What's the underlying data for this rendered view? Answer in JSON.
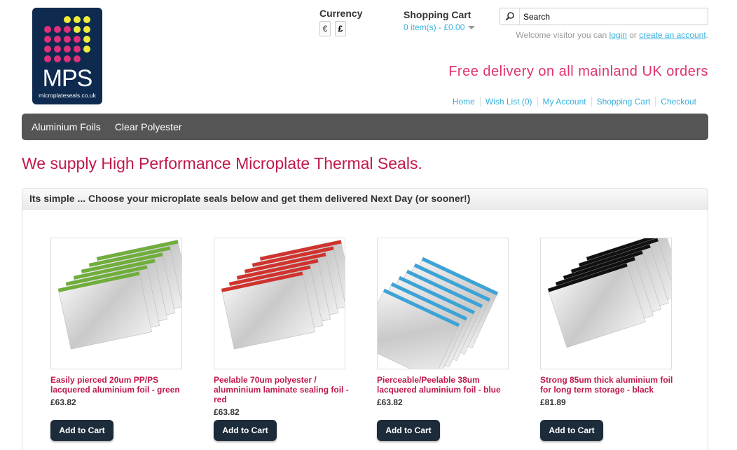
{
  "logo": {
    "brand": "MPS",
    "url": "microplateseals.co.uk"
  },
  "currency": {
    "title": "Currency",
    "options": [
      "€",
      "£"
    ]
  },
  "cart": {
    "title": "Shopping Cart",
    "summary": "0 item(s) - £0.00"
  },
  "search": {
    "placeholder": "Search"
  },
  "welcome": {
    "prefix": "Welcome visitor you can ",
    "login": "login",
    "middle": " or ",
    "create": "create an account",
    "suffix": "."
  },
  "promo": "Free delivery on all mainland UK orders",
  "top_links": [
    "Home",
    "Wish List (0)",
    "My Account",
    "Shopping Cart",
    "Checkout"
  ],
  "menu": [
    "Aluminium Foils",
    "Clear Polyester"
  ],
  "headline": "We supply High Performance Microplate Thermal Seals.",
  "box_title": "Its simple ... Choose your microplate seals below and get them delivered Next Day (or sooner!)",
  "products": [
    {
      "name": "Easily pierced 20um PP/PS lacquered aluminium foil - green",
      "price": "£63.82",
      "button": "Add to Cart",
      "color": "#6fae3a"
    },
    {
      "name": "Peelable 70um polyester / alumninium laminate sealing foil - red",
      "price": "£63.82",
      "button": "Add to Cart",
      "color": "#d0332e"
    },
    {
      "name": "Pierceable/Peelable 38um lacquered aluminium foil - blue",
      "price": "£63.82",
      "button": "Add to Cart",
      "color": "#3ba3d8"
    },
    {
      "name": "Strong 85um thick aluminium foil for long term storage - black",
      "price": "£81.89",
      "button": "Add to Cart",
      "color": "#111111"
    }
  ],
  "colors": {
    "accent": "#c0184a",
    "link": "#38b0de",
    "promo": "#e0336a",
    "menu_bg": "#555555",
    "button_bg": "#1d2c3a"
  }
}
